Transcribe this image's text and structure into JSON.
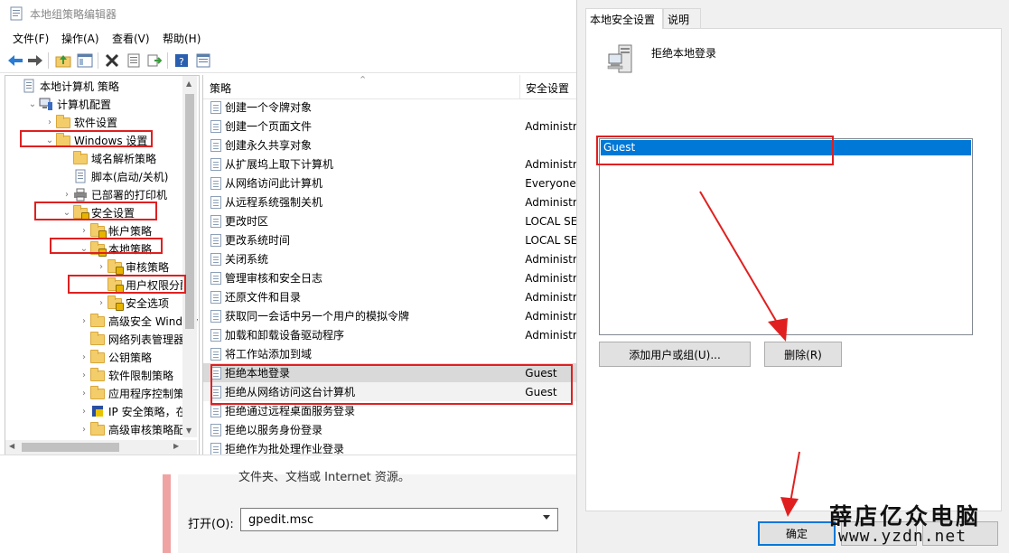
{
  "window": {
    "title": "本地组策略编辑器"
  },
  "menu": [
    "文件(F)",
    "操作(A)",
    "查看(V)",
    "帮助(H)"
  ],
  "toolbar_icons": [
    "back-arrow-icon",
    "forward-arrow-icon",
    "up-folder-icon",
    "show-tree-icon",
    "delete-x-icon",
    "properties-icon",
    "export-icon",
    "help-icon",
    "extended-view-icon"
  ],
  "tree": [
    {
      "label": "本地计算机 策略",
      "indent": 0,
      "arrow": "",
      "icon": "doc"
    },
    {
      "label": "计算机配置",
      "indent": 1,
      "arrow": "open",
      "icon": "computer"
    },
    {
      "label": "软件设置",
      "indent": 2,
      "arrow": "closed",
      "icon": "folder"
    },
    {
      "label": "Windows 设置",
      "indent": 2,
      "arrow": "open",
      "icon": "folder"
    },
    {
      "label": "域名解析策略",
      "indent": 3,
      "arrow": "",
      "icon": "folder"
    },
    {
      "label": "脚本(启动/关机)",
      "indent": 3,
      "arrow": "",
      "icon": "doc"
    },
    {
      "label": "已部署的打印机",
      "indent": 3,
      "arrow": "closed",
      "icon": "printer"
    },
    {
      "label": "安全设置",
      "indent": 3,
      "arrow": "open",
      "icon": "lockfolder"
    },
    {
      "label": "帐户策略",
      "indent": 4,
      "arrow": "closed",
      "icon": "lockfolder"
    },
    {
      "label": "本地策略",
      "indent": 4,
      "arrow": "open",
      "icon": "lockfolder"
    },
    {
      "label": "审核策略",
      "indent": 5,
      "arrow": "closed",
      "icon": "lockfolder"
    },
    {
      "label": "用户权限分配",
      "indent": 5,
      "arrow": "",
      "icon": "lockfolder"
    },
    {
      "label": "安全选项",
      "indent": 5,
      "arrow": "closed",
      "icon": "lockfolder"
    },
    {
      "label": "高级安全 Window",
      "indent": 4,
      "arrow": "closed",
      "icon": "folder"
    },
    {
      "label": "网络列表管理器策",
      "indent": 4,
      "arrow": "",
      "icon": "folder"
    },
    {
      "label": "公钥策略",
      "indent": 4,
      "arrow": "closed",
      "icon": "folder"
    },
    {
      "label": "软件限制策略",
      "indent": 4,
      "arrow": "closed",
      "icon": "folder"
    },
    {
      "label": "应用程序控制策略",
      "indent": 4,
      "arrow": "closed",
      "icon": "folder"
    },
    {
      "label": "IP 安全策略，在 ž",
      "indent": 4,
      "arrow": "closed",
      "icon": "shield"
    },
    {
      "label": "高级审核策略配置",
      "indent": 4,
      "arrow": "closed",
      "icon": "folder"
    }
  ],
  "list": {
    "col_policy": "策略",
    "col_setting": "安全设置",
    "rows": [
      {
        "name": "创建一个令牌对象",
        "setting": ""
      },
      {
        "name": "创建一个页面文件",
        "setting": "Administr"
      },
      {
        "name": "创建永久共享对象",
        "setting": ""
      },
      {
        "name": "从扩展坞上取下计算机",
        "setting": "Administr"
      },
      {
        "name": "从网络访问此计算机",
        "setting": "Everyone,"
      },
      {
        "name": "从远程系统强制关机",
        "setting": "Administr"
      },
      {
        "name": "更改时区",
        "setting": "LOCAL SE"
      },
      {
        "name": "更改系统时间",
        "setting": "LOCAL SE"
      },
      {
        "name": "关闭系统",
        "setting": "Administr"
      },
      {
        "name": "管理审核和安全日志",
        "setting": "Administr"
      },
      {
        "name": "还原文件和目录",
        "setting": "Administr"
      },
      {
        "name": "获取同一会话中另一个用户的模拟令牌",
        "setting": "Administr"
      },
      {
        "name": "加载和卸载设备驱动程序",
        "setting": "Administr"
      },
      {
        "name": "将工作站添加到域",
        "setting": ""
      },
      {
        "name": "拒绝本地登录",
        "setting": "Guest"
      },
      {
        "name": "拒绝从网络访问这台计算机",
        "setting": "Guest"
      },
      {
        "name": "拒绝通过远程桌面服务登录",
        "setting": ""
      },
      {
        "name": "拒绝以服务身份登录",
        "setting": ""
      },
      {
        "name": "拒绝作为批处理作业登录",
        "setting": ""
      }
    ]
  },
  "run": {
    "cut_text": "文件夹、文档或 Internet 资源。",
    "open_label": "打开(O):",
    "value": "gpedit.msc"
  },
  "props": {
    "tab_local": "本地安全设置",
    "tab_explain": "说明",
    "policy_title": "拒绝本地登录",
    "users": [
      "Guest"
    ],
    "add_button": "添加用户或组(U)...",
    "remove_button": "删除(R)",
    "ok_button": "确定"
  },
  "watermark": {
    "line1": "薛店亿众电脑",
    "line2": "www.yzdn.net"
  },
  "colors": {
    "selection": "#0078d7",
    "annotation": "#e02020"
  }
}
